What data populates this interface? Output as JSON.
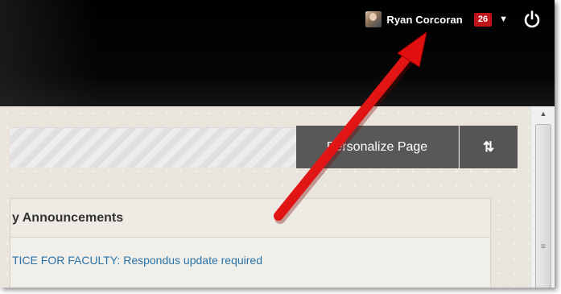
{
  "header": {
    "user_name": "Ryan Corcoran",
    "notification_count": "26",
    "menu_chevron": "▼",
    "avatar_icon": "user-avatar-photo",
    "power_icon": "power-icon"
  },
  "toolbar": {
    "personalize_label": "Personalize Page",
    "reorder_label": "⇅"
  },
  "module": {
    "title": "y Announcements",
    "link_text": "TICE FOR FACULTY: Respondus update required"
  },
  "scrollbar": {
    "up_arrow": "▲"
  },
  "colors": {
    "header_bg": "#000000",
    "badge_bg": "#c0141a",
    "button_bg": "#585858",
    "link": "#2a73a8",
    "arrow": "#e01010"
  }
}
